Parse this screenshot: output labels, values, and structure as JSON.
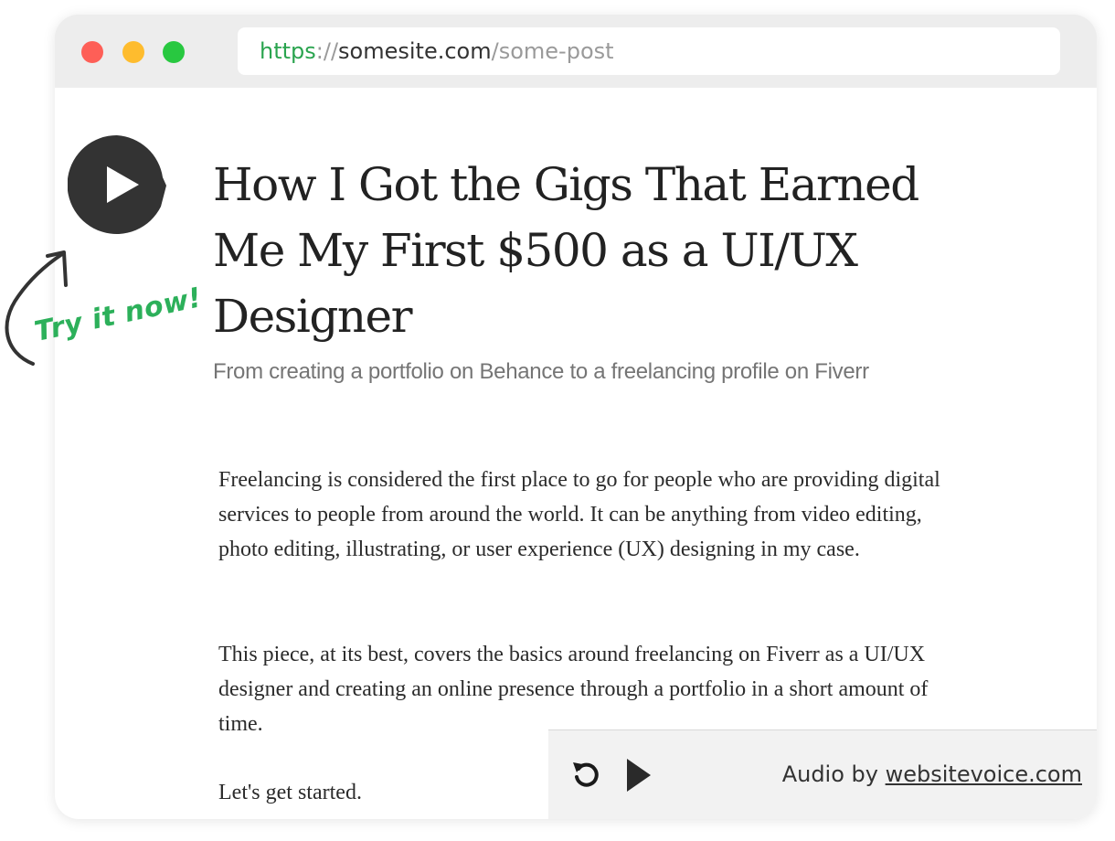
{
  "browser": {
    "url": {
      "scheme": "https",
      "separator": "://",
      "host": "somesite.com",
      "path": "/some-post"
    }
  },
  "article": {
    "title": "How I Got the Gigs That Earned Me My First $500 as a UI/UX Designer",
    "subtitle": "From creating a portfolio on Behance to a freelancing profile on Fiverr",
    "paragraphs": [
      "Freelancing is considered the first place to go for people who are providing digital services to people from around the world. It can be anything from video editing, photo editing, illustrating, or user experience (UX) designing in my case.",
      "This piece, at its best, covers the basics around freelancing on Fiverr as a UI/UX designer and creating an online presence through a portfolio in a short amount of time.",
      "Let's get started."
    ]
  },
  "cta": {
    "text": "Try it now!",
    "color": "#2cb05a"
  },
  "player": {
    "credit_prefix": "Audio by ",
    "credit_link": "websitevoice.com",
    "icons": [
      "replay-icon",
      "play-icon"
    ]
  },
  "colors": {
    "traffic_red": "#fe5f57",
    "traffic_yellow": "#febc2e",
    "traffic_green": "#28c840",
    "url_scheme": "#2aa44f",
    "play_bubble": "#333333"
  }
}
